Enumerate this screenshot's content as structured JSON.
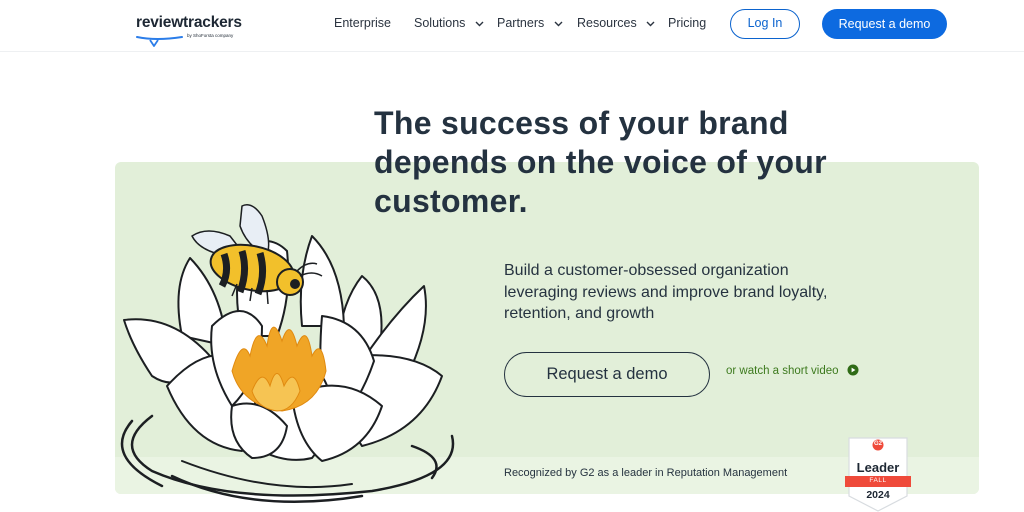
{
  "header": {
    "logo_text": "reviewtrackers",
    "logo_subtext": "by ShoForsta company",
    "nav": [
      {
        "label": "Enterprise",
        "has_dropdown": false
      },
      {
        "label": "Solutions",
        "has_dropdown": true
      },
      {
        "label": "Partners",
        "has_dropdown": true
      },
      {
        "label": "Resources",
        "has_dropdown": true
      },
      {
        "label": "Pricing",
        "has_dropdown": false
      }
    ],
    "login_label": "Log In",
    "demo_label": "Request a demo"
  },
  "hero": {
    "headline_lines": [
      "The success of your brand",
      "depends on the voice of your",
      "customer."
    ],
    "subtext_lines": [
      "Build a customer-obsessed organization",
      "leveraging reviews and improve brand loyalty,",
      "retention, and growth"
    ],
    "cta_label": "Request a demo",
    "video_link": "or watch a short video",
    "recognition_text": "Recognized by G2 as a leader in Reputation Management"
  },
  "badge": {
    "logo": "G2",
    "title": "Leader",
    "season": "FALL",
    "year": "2024"
  },
  "colors": {
    "primary_blue": "#0d6ae0",
    "hero_green": "#e2efd9",
    "dark_text": "#243240",
    "link_green": "#3d7a1e",
    "g2_red": "#ef4a3a",
    "bee_yellow": "#f2c02b",
    "flame_orange": "#f0a526"
  },
  "icons": {
    "dropdown": "chevron-down-icon",
    "play": "play-circle-icon",
    "illustration": "bee-on-lotus-illustration"
  }
}
